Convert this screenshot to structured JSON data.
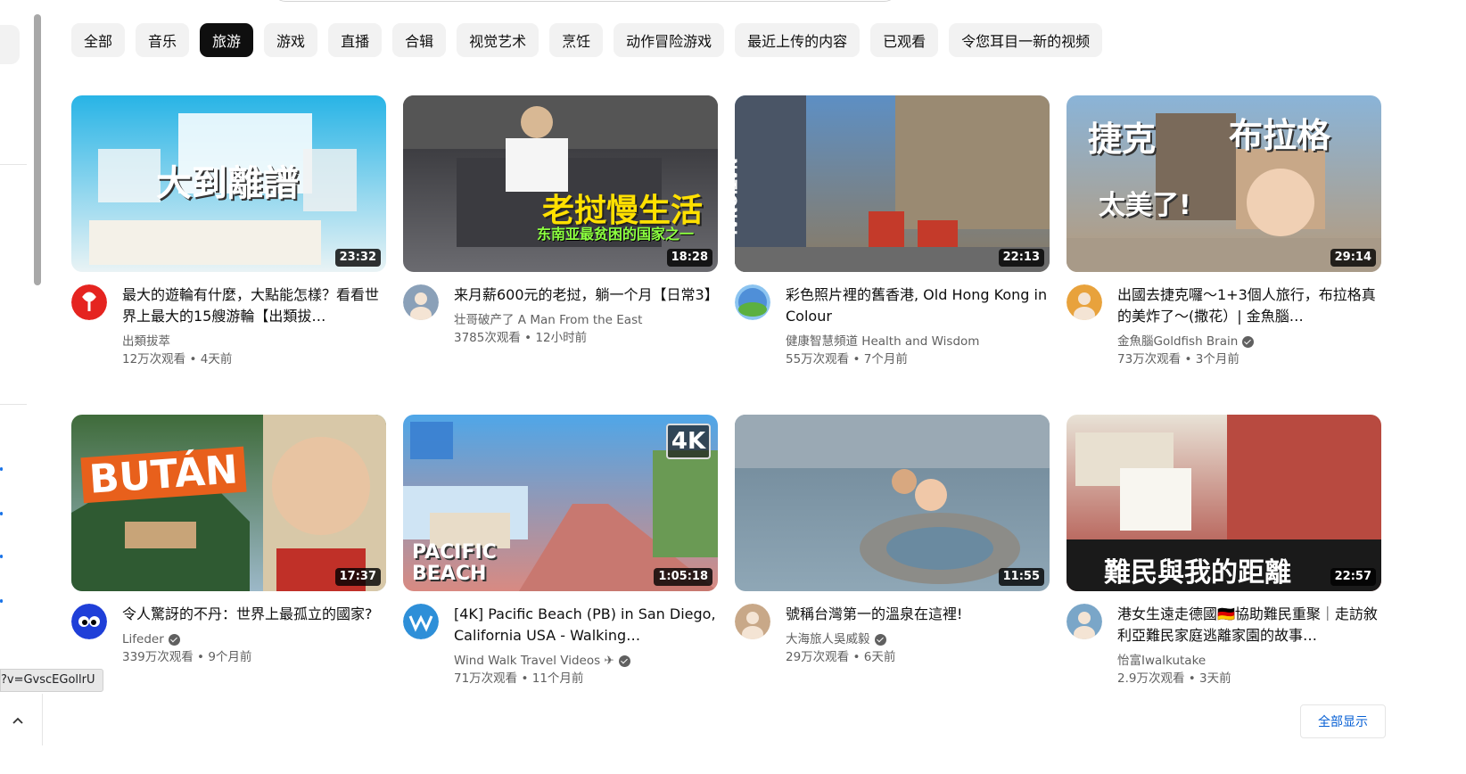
{
  "chips": [
    "全部",
    "音乐",
    "旅游",
    "游戏",
    "直播",
    "合辑",
    "视觉艺术",
    "烹饪",
    "动作冒险游戏",
    "最近上传的内容",
    "已观看",
    "令您耳目一新的视频"
  ],
  "selected_chip": "旅游",
  "videos": [
    {
      "title": "最大的遊輪有什麼，大點能怎樣？看看世界上最大的15艘游輪【出類拔…",
      "channel": "出類拔萃",
      "verified": false,
      "stats": "12万次观看 • 4天前",
      "duration": "23:32",
      "thumb_text": "大到離譜",
      "thumb_colors": [
        "#28b4e6",
        "#e9f3f5"
      ],
      "avatar_color": "#e52420"
    },
    {
      "title": "来月薪600元的老挝，躺一个月【日常3】",
      "channel": "壮哥破产了 A Man From the East",
      "verified": false,
      "stats": "3785次观看 • 12小时前",
      "duration": "18:28",
      "thumb_text": "老挝慢生活",
      "thumb_subtext": "东南亚最贫困的国家之一",
      "thumb_colors": [
        "#2a2a2e",
        "#6b6b70"
      ],
      "avatar_color": "#8aa0b8"
    },
    {
      "title": "彩色照片裡的舊香港, Old Hong Kong in Colour",
      "channel": "健康智慧頻道 Health and Wisdom",
      "verified": false,
      "stats": "55万次观看 • 7个月前",
      "duration": "22:13",
      "thumb_text": "NATIONAL",
      "thumb_colors": [
        "#5d8fc4",
        "#8a7a62"
      ],
      "avatar_color": "#4f8fd8"
    },
    {
      "title": "出國去捷克囉～1+3個人旅行，布拉格真的美炸了～(撒花）| 金魚腦…",
      "channel": "金魚腦Goldfish Brain",
      "verified": true,
      "stats": "73万次观看 • 3个月前",
      "duration": "29:14",
      "thumb_text": "捷克",
      "thumb_text2": "布拉格",
      "thumb_text3": "太美了!",
      "thumb_colors": [
        "#8ab4d8",
        "#b69a7a"
      ],
      "avatar_color": "#e8a23c"
    },
    {
      "title": "令人驚訝的不丹：世界上最孤立的國家?",
      "channel": "Lifeder",
      "verified": true,
      "stats": "339万次观看 • 9个月前",
      "duration": "17:37",
      "thumb_text": "BUTÁN",
      "thumb_colors": [
        "#3f6b3a",
        "#9cb8c8"
      ],
      "avatar_color": "#1f3fd8"
    },
    {
      "title": "[4K] Pacific Beach (PB) in San Diego, California USA - Walking…",
      "channel": "Wind Walk Travel Videos ✈",
      "verified": true,
      "stats": "71万次观看 • 11个月前",
      "duration": "1:05:18",
      "thumb_text": "PACIFIC",
      "thumb_text2": "BEACH",
      "badge": "4K",
      "thumb_colors": [
        "#4fa6e8",
        "#d88a82"
      ],
      "avatar_color": "#2e8fd8"
    },
    {
      "title": "號稱台灣第一的溫泉在這裡!",
      "channel": "大海旅人吳威毅",
      "verified": true,
      "stats": "29万次观看 • 6天前",
      "duration": "11:55",
      "thumb_colors": [
        "#6d8596",
        "#8fa7b6"
      ],
      "avatar_color": "#c8a888"
    },
    {
      "title": "港女生遠走德國🇩🇪協助難民重聚｜走訪敘利亞難民家庭逃離家園的故事…",
      "channel": "怡富Iwalkutake",
      "verified": false,
      "stats": "2.9万次观看 • 3天前",
      "duration": "22:57",
      "thumb_text": "難民與我的距離",
      "thumb_colors": [
        "#e8e2d6",
        "#a83a32"
      ],
      "avatar_color": "#7aa6c8"
    }
  ],
  "url_tooltip": "?v=GvscEGollrU",
  "show_all_label": "全部显示",
  "icons": {
    "scroll_up": "chevron-up-icon",
    "verified": "verified-check-icon"
  }
}
